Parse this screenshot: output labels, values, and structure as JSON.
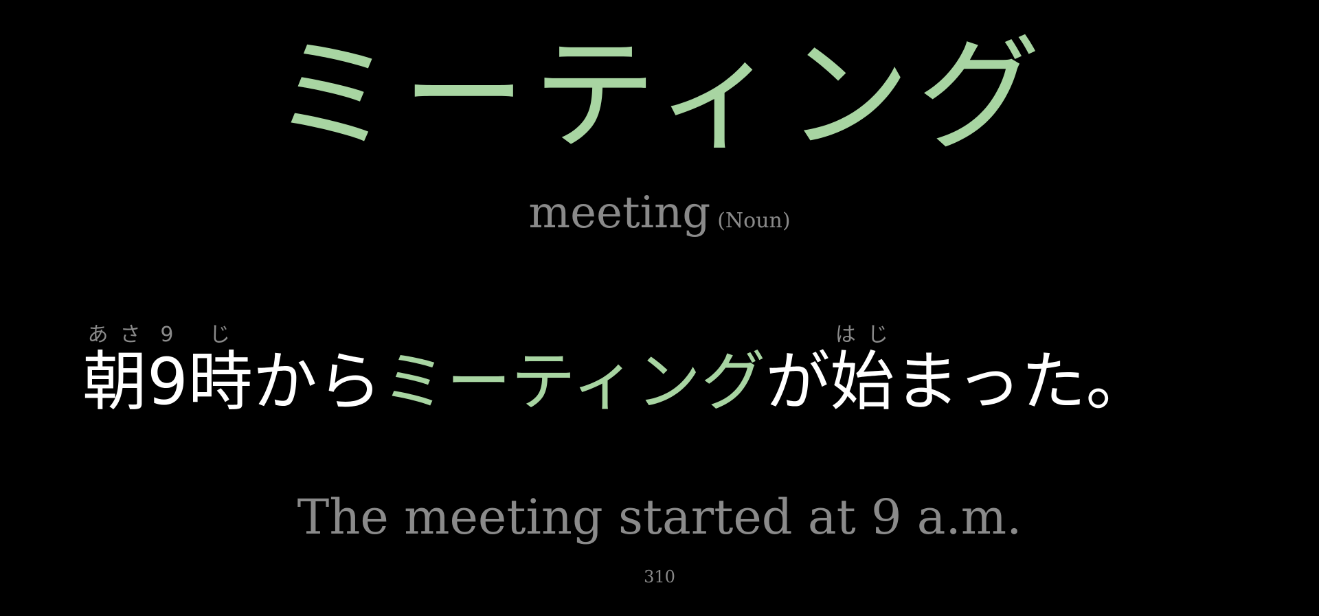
{
  "card": {
    "headword": "ミーティング",
    "gloss": "meeting",
    "part_of_speech": "(Noun)",
    "sentence": {
      "seg1_base": "朝",
      "seg1_reading": "あさ",
      "seg2_base": "9",
      "seg2_reading": "9",
      "seg3_base": "時",
      "seg3_reading": "じ",
      "seg4": "から",
      "seg5_highlight": "ミーティング",
      "seg6": "が",
      "seg7_base": "始",
      "seg7_reading": "はじ",
      "seg8": "まった。"
    },
    "translation": "The meeting started at 9 a.m.",
    "number": "310"
  },
  "colors": {
    "background": "#000000",
    "accent": "#a8d5a2",
    "text": "#ffffff",
    "muted": "#8a8a8a"
  }
}
